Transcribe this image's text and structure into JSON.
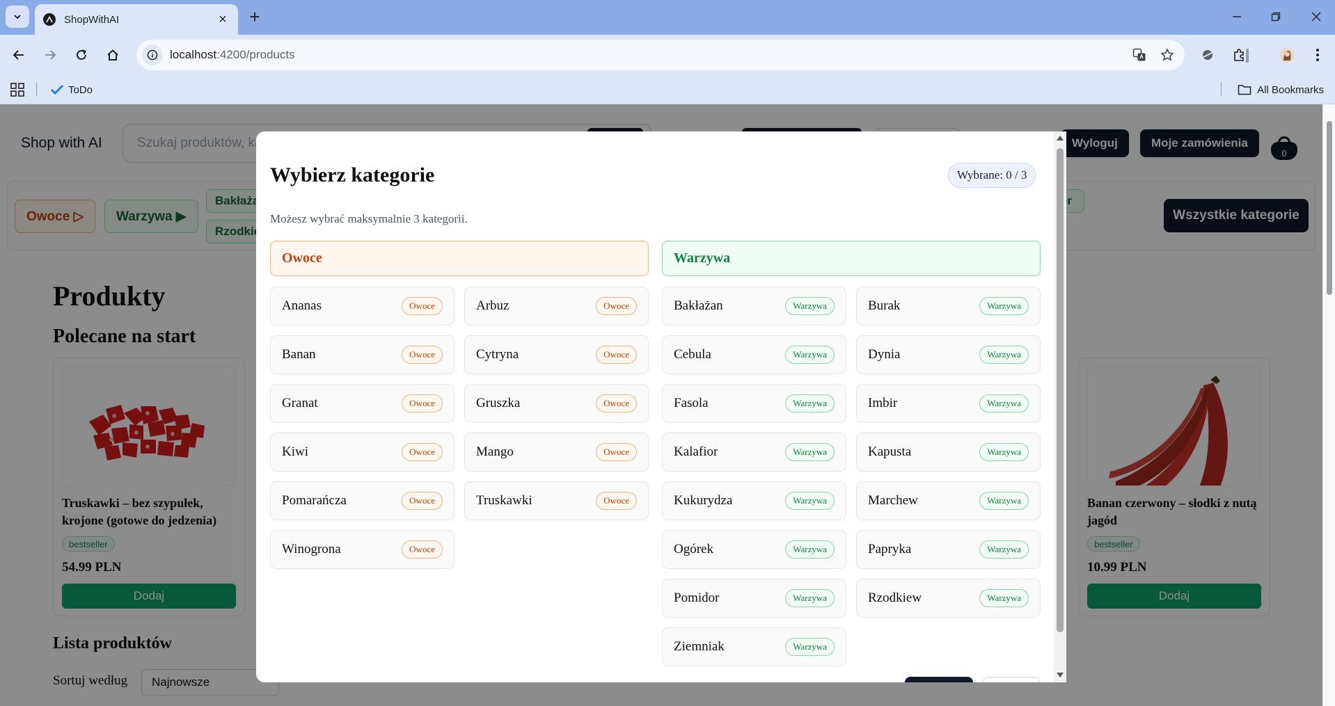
{
  "browser": {
    "tab_title": "ShopWithAI",
    "url_host": "localhost",
    "url_rest": ":4200/products",
    "bookmark_todo": "ToDo",
    "all_bookmarks": "All Bookmarks"
  },
  "site": {
    "brand": "Shop with AI",
    "search_placeholder": "Szukaj produktów, ka",
    "logout": "Wyloguj",
    "orders": "Moje zamówienia",
    "cart_count": "0",
    "cat_owoce": "Owoce ▷",
    "cat_warzywa": "Warzywa ▶",
    "sub_baklazan": "Bakłaża",
    "sub_rzodkiew": "Rzodkie",
    "sub_right": "or",
    "all_categories": "Wszystkie kategorie",
    "heading_products": "Produkty",
    "heading_featured": "Polecane na start",
    "heading_list": "Lista produktów",
    "sort_label": "Sortuj według",
    "sort_value": "Najnowsze"
  },
  "cards": [
    {
      "title": "Truskawki – bez szypułek, krojone (gotowe do jedzenia)",
      "badge": "bestseller",
      "price": "54.99 PLN",
      "button": "Dodaj"
    },
    {
      "title": "Banan czerwony – słodki z nutą jagód",
      "badge": "bestseller",
      "price": "10.99 PLN",
      "button": "Dodaj"
    }
  ],
  "modal": {
    "title": "Wybierz kategorie",
    "counter": "Wybrane: 0 / 3",
    "subtitle": "Możesz wybrać maksymalnie 3 kategorii.",
    "groups": [
      {
        "name": "Owoce",
        "tag": "Owoce",
        "items": [
          "Ananas",
          "Arbuz",
          "Banan",
          "Cytryna",
          "Granat",
          "Gruszka",
          "Kiwi",
          "Mango",
          "Pomarańcza",
          "Truskawki",
          "Winogrona"
        ]
      },
      {
        "name": "Warzywa",
        "tag": "Warzywa",
        "items": [
          "Bakłażan",
          "Burak",
          "Cebula",
          "Dynia",
          "Fasola",
          "Imbir",
          "Kalafior",
          "Kapusta",
          "Kukurydza",
          "Marchew",
          "Ogórek",
          "Papryka",
          "Pomidor",
          "Rzodkiew",
          "Ziemniak"
        ]
      }
    ]
  },
  "colors": {
    "owoce_accent": "#c2410c",
    "warzywa_accent": "#15803d",
    "primary_dark": "#111827",
    "add_button": "#10a06c"
  }
}
